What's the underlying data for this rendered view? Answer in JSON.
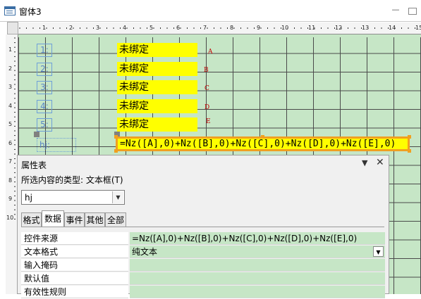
{
  "window": {
    "title": "窗体3"
  },
  "ruler": {
    "top": [
      "1",
      "2",
      "3",
      "4",
      "5",
      "6",
      "7",
      "8",
      "9",
      "10",
      "11",
      "12",
      "13",
      "14",
      "15"
    ],
    "left": [
      "1",
      "2",
      "3",
      "4",
      "5",
      "6",
      "7",
      "8",
      "9",
      "10"
    ]
  },
  "design": {
    "number_labels": [
      "1:",
      "2:",
      "3:",
      "4:",
      "5:"
    ],
    "unbound_text": "未绑定",
    "letters": [
      "A",
      "B",
      "C",
      "D",
      "E"
    ],
    "hj_label": "hj:",
    "formula": "=Nz([A],0)+Nz([B],0)+Nz([C],0)+Nz([D],0)+Nz([E],0)"
  },
  "property_sheet": {
    "title": "属性表",
    "selection_type_label": "所选内容的类型: 文本框(T)",
    "selected_control": "hj",
    "tabs": [
      "格式",
      "数据",
      "事件",
      "其他",
      "全部"
    ],
    "active_tab": "数据",
    "rows": [
      {
        "label": "控件来源",
        "value": "=Nz([A],0)+Nz([B],0)+Nz([C],0)+Nz([D],0)+Nz([E],0)"
      },
      {
        "label": "文本格式",
        "value": "纯文本"
      },
      {
        "label": "输入掩码",
        "value": ""
      },
      {
        "label": "默认值",
        "value": ""
      },
      {
        "label": "有效性规则",
        "value": ""
      }
    ]
  }
}
